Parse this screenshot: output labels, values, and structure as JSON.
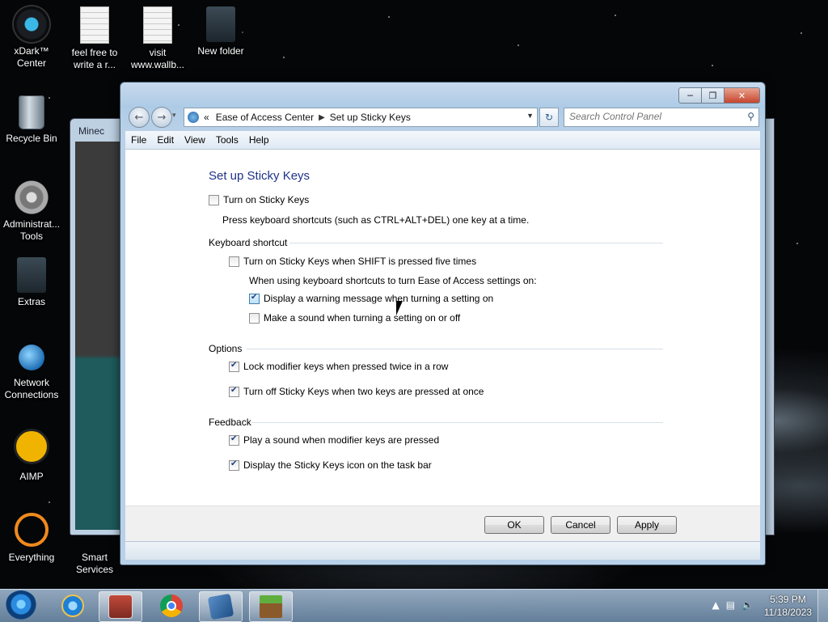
{
  "desktop": {
    "icons": [
      {
        "label": "xDark™ Center"
      },
      {
        "label": "feel free to write a r..."
      },
      {
        "label": "visit www.wallb..."
      },
      {
        "label": "New folder"
      },
      {
        "label": "Recycle Bin"
      },
      {
        "label": "Administrat... Tools"
      },
      {
        "label": "Extras"
      },
      {
        "label": "Network Connections"
      },
      {
        "label": "AIMP"
      },
      {
        "label": "Everything"
      },
      {
        "label": "Smart Services"
      }
    ],
    "background_window_title": "Minec"
  },
  "window": {
    "breadcrumb_prefix": "«",
    "breadcrumb": [
      "Ease of Access Center",
      "Set up Sticky Keys"
    ],
    "search_placeholder": "Search Control Panel",
    "menu": [
      "File",
      "Edit",
      "View",
      "Tools",
      "Help"
    ],
    "page_title": "Set up Sticky Keys",
    "turn_on": {
      "label": "Turn on Sticky Keys",
      "checked": false
    },
    "turn_on_desc": "Press keyboard shortcuts (such as CTRL+ALT+DEL) one key at a time.",
    "keyboard_shortcut": {
      "heading": "Keyboard shortcut",
      "shift_five": {
        "label": "Turn on Sticky Keys when SHIFT is pressed five times",
        "checked": false
      },
      "sub_desc": "When using keyboard shortcuts to turn Ease of Access settings on:",
      "warning": {
        "label": "Display a warning message when turning a setting on",
        "checked": true
      },
      "sound": {
        "label": "Make a sound when turning a setting on or off",
        "checked": false
      }
    },
    "options": {
      "heading": "Options",
      "lock": {
        "label": "Lock modifier keys when pressed twice in a row",
        "checked": true
      },
      "turn_off": {
        "label": "Turn off Sticky Keys when two keys are pressed at once",
        "checked": true
      }
    },
    "feedback": {
      "heading": "Feedback",
      "play_sound": {
        "label": "Play a sound when modifier keys are pressed",
        "checked": true
      },
      "taskbar_icon": {
        "label": "Display the Sticky Keys icon on the task bar",
        "checked": true
      }
    },
    "buttons": {
      "ok": "OK",
      "cancel": "Cancel",
      "apply": "Apply"
    }
  },
  "taskbar": {
    "time": "5:39 PM",
    "date": "11/18/2023",
    "apps": [
      "internet-explorer-icon",
      "file-manager-icon",
      "chrome-icon",
      "control-panel-icon",
      "minecraft-icon"
    ]
  },
  "colors": {
    "title_blue": "#1e3287",
    "accent": "#2c5d8f"
  }
}
